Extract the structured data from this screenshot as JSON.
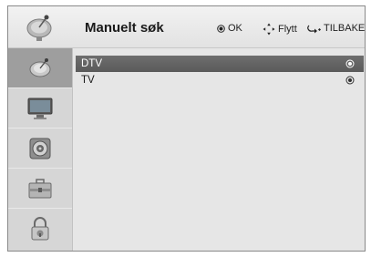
{
  "header": {
    "title": "Manuelt søk",
    "help": {
      "ok_label": "OK",
      "move_label": "Flytt",
      "back_label": "TILBAKE"
    },
    "icon": "satellite-dish-icon"
  },
  "sidebar": {
    "items": [
      {
        "icon": "satellite-dish-icon",
        "active": true
      },
      {
        "icon": "tv-screen-icon",
        "active": false
      },
      {
        "icon": "speaker-icon",
        "active": false
      },
      {
        "icon": "toolbox-icon",
        "active": false
      },
      {
        "icon": "padlock-icon",
        "active": false
      }
    ]
  },
  "options": [
    {
      "label": "DTV",
      "selected": true
    },
    {
      "label": "TV",
      "selected": false
    }
  ],
  "colors": {
    "selected_row": "#5f5f5f",
    "active_sidebar": "#9e9e9e",
    "panel": "#e6e6e6"
  }
}
